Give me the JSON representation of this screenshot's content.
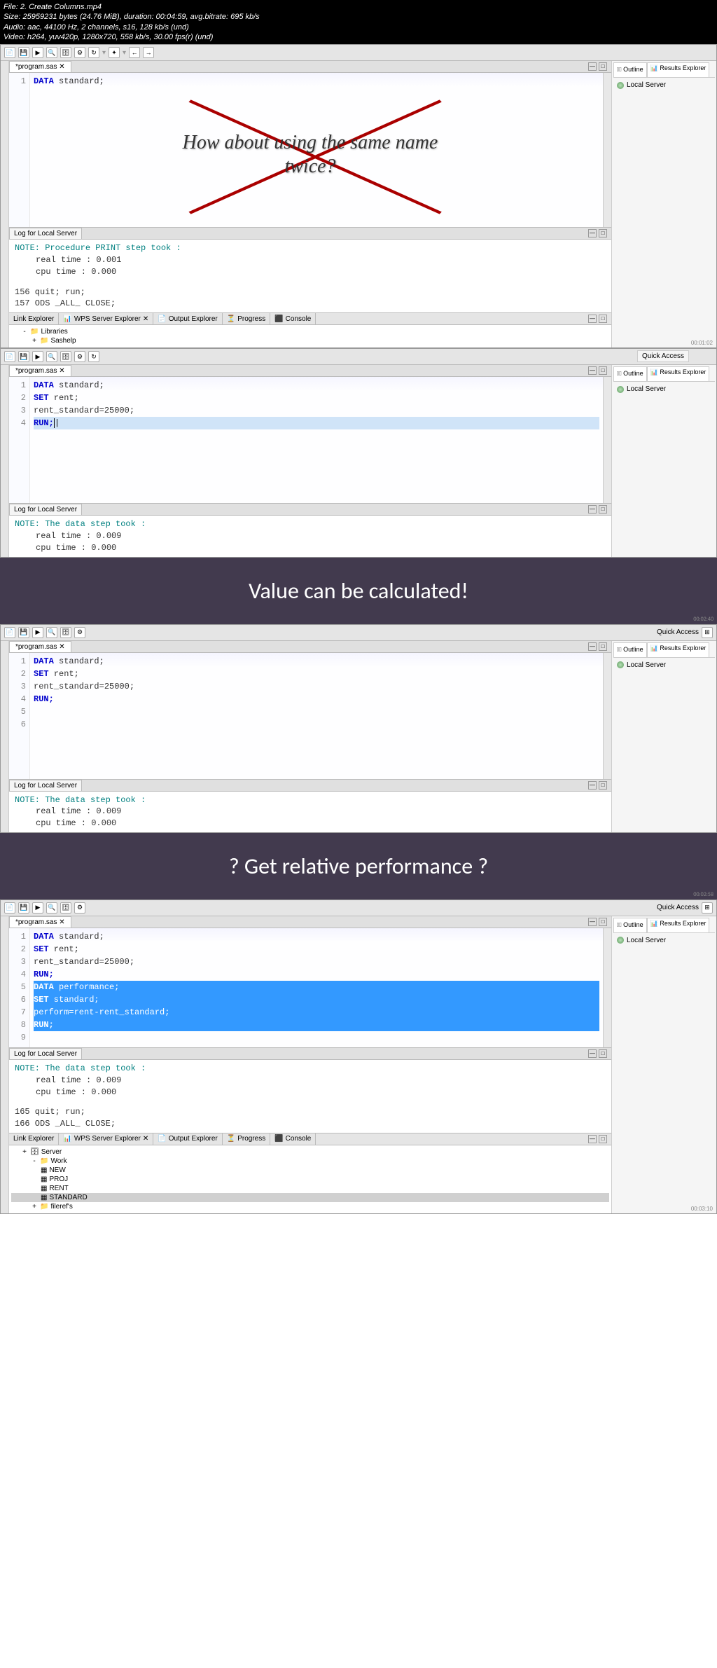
{
  "header": {
    "line1": "File: 2. Create Columns.mp4",
    "line2": "Size: 25959231 bytes (24.76 MiB), duration: 00:04:59, avg.bitrate: 695 kb/s",
    "line3": "Audio: aac, 44100 Hz, 2 channels, s16, 128 kb/s (und)",
    "line4": "Video: h264, yuv420p, 1280x720, 558 kb/s, 30.00 fps(r) (und)"
  },
  "quick_access": "Quick Access",
  "overlay_question": "How about using the same name twice?",
  "banner1": "Value can be calculated!",
  "banner2": "? Get relative performance ?",
  "frame1": {
    "tab": "*program.sas",
    "code": {
      "lines": [
        {
          "n": "1",
          "kw": "DATA",
          "rest": " standard;"
        }
      ]
    },
    "right_tabs": [
      "Outline",
      "Results Explorer"
    ],
    "local_server": "Local Server",
    "log_tab": "Log for Local Server",
    "log_note": "NOTE: Procedure PRINT step took :",
    "log_time1": "real time : 0.001",
    "log_time2": "cpu time  : 0.000",
    "log_lines": [
      {
        "n": "156",
        "txt": "      quit; run;"
      },
      {
        "n": "157",
        "txt": "      ODS _ALL_ CLOSE;"
      }
    ],
    "bottom_tabs": [
      "Link Explorer",
      "WPS Server Explorer",
      "Output Explorer",
      "Progress",
      "Console"
    ],
    "tree": [
      {
        "exp": "-",
        "label": "Libraries"
      },
      {
        "exp": "+",
        "label": "Sashelp"
      }
    ],
    "timestamp": "00:01:02"
  },
  "frame2": {
    "tab": "*program.sas",
    "code": {
      "l1": {
        "kw": "DATA",
        "rest": " standard;"
      },
      "l2": {
        "kw": "SET",
        "rest": " rent;"
      },
      "l3": {
        "rest": "rent_standard=25000;"
      },
      "l4": {
        "kw": "RUN;",
        "cursor": "|"
      }
    },
    "log_tab": "Log for Local Server",
    "log_note": "NOTE: The data step took :",
    "log_time1": "real time : 0.009",
    "log_time2": "cpu time  : 0.000",
    "right_tabs": [
      "Outline",
      "Results Explorer"
    ],
    "local_server": "Local Server",
    "timestamp": "00:02:40"
  },
  "frame3": {
    "tab": "*program.sas",
    "code": {
      "l1": {
        "kw": "DATA",
        "rest": " standard;"
      },
      "l2": {
        "kw": "SET",
        "rest": " rent;"
      },
      "l3": {
        "rest": "rent_standard=25000;"
      },
      "l4": {
        "kw": "RUN;"
      },
      "l5": {
        "rest": ""
      },
      "l6": {
        "rest": ""
      }
    },
    "log_tab": "Log for Local Server",
    "log_note": "NOTE: The data step took :",
    "log_time1": "real time : 0.009",
    "log_time2": "cpu time  : 0.000",
    "right_tabs": [
      "Outline",
      "Results Explorer"
    ],
    "local_server": "Local Server",
    "timestamp": "00:02:58"
  },
  "frame4": {
    "tab": "*program.sas",
    "code": {
      "l1": {
        "kw": "DATA",
        "rest": " standard;"
      },
      "l2": {
        "kw": "SET",
        "rest": " rent;"
      },
      "l3": {
        "rest": "rent_standard=25000;"
      },
      "l4": {
        "kw": "RUN;"
      },
      "l5": {
        "rest": ""
      },
      "l6": {
        "kw": "DATA",
        "rest": " performance;"
      },
      "l7": {
        "kw": "SET",
        "rest": " standard;"
      },
      "l8": {
        "rest": "perform=rent-rent_standard;"
      },
      "l9": {
        "kw": "RUN;"
      }
    },
    "log_tab": "Log for Local Server",
    "log_note": "NOTE: The data step took :",
    "log_time1": "real time : 0.009",
    "log_time2": "cpu time  : 0.000",
    "log_lines": [
      {
        "n": "165",
        "txt": "      quit; run;"
      },
      {
        "n": "166",
        "txt": "      ODS _ALL_ CLOSE;"
      }
    ],
    "right_tabs": [
      "Outline",
      "Results Explorer"
    ],
    "local_server": "Local Server",
    "bottom_tabs": [
      "Link Explorer",
      "WPS Server Explorer",
      "Output Explorer",
      "Progress",
      "Console"
    ],
    "tree": [
      {
        "exp": "+",
        "label": "Server"
      },
      {
        "exp": "-",
        "label": "Work"
      },
      {
        "exp": "",
        "label": "NEW"
      },
      {
        "exp": "",
        "label": "PROJ"
      },
      {
        "exp": "",
        "label": "RENT"
      },
      {
        "exp": "",
        "label": "STANDARD",
        "sel": true
      },
      {
        "exp": "+",
        "label": "fileref's"
      }
    ],
    "timestamp": "00:03:10"
  }
}
